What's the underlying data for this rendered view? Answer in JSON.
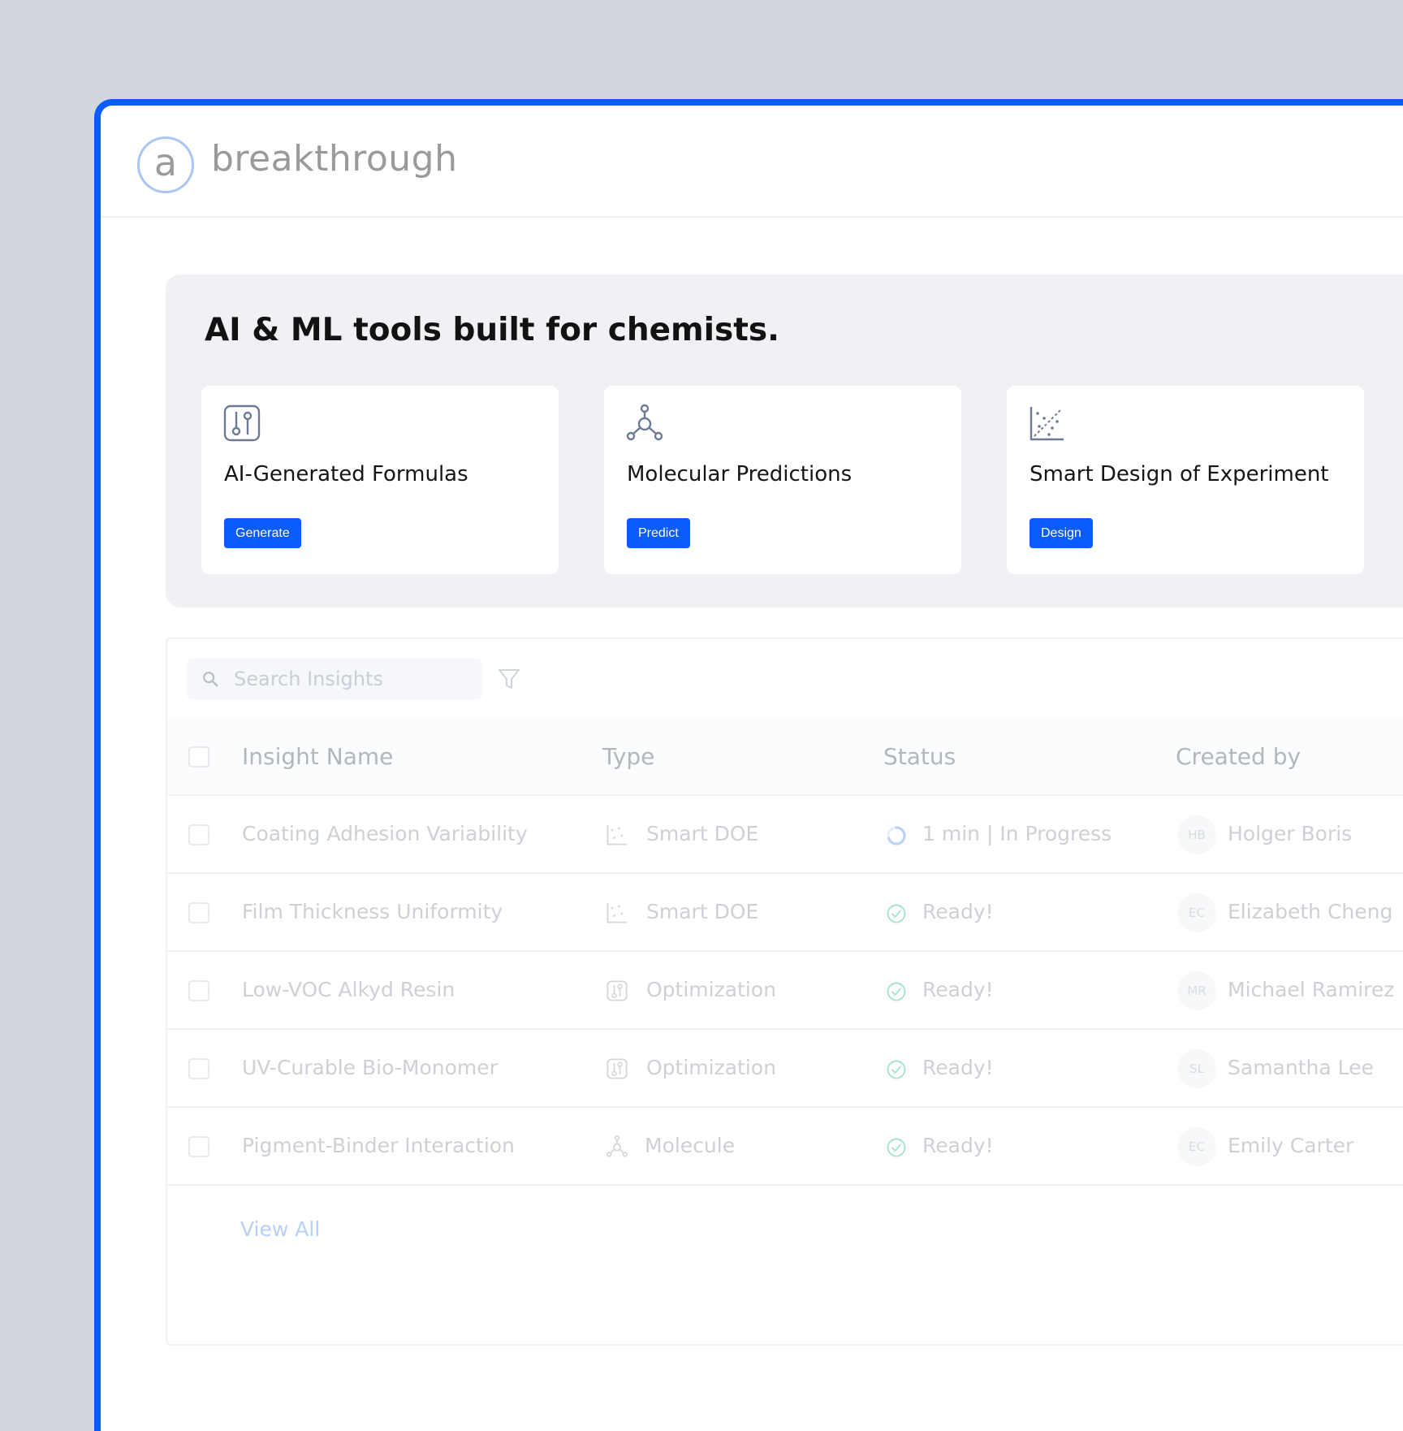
{
  "brand": {
    "logo_letter": "a",
    "name": "breakthrough"
  },
  "hero": {
    "title": "AI & ML tools built for chemists.",
    "tools": [
      {
        "icon": "sliders-icon",
        "title": "AI-Generated Formulas",
        "button": "Generate"
      },
      {
        "icon": "molecule-icon",
        "title": "Molecular Predictions",
        "button": "Predict"
      },
      {
        "icon": "scatter-chart-icon",
        "title": "Smart Design of Experiment",
        "button": "Design"
      }
    ]
  },
  "search": {
    "placeholder": "Search Insights"
  },
  "table": {
    "columns": [
      "Insight Name",
      "Type",
      "Status",
      "Created by"
    ],
    "rows": [
      {
        "name": "Coating Adhesion Variability",
        "type": "Smart DOE",
        "type_icon": "scatter-chart-icon",
        "status": "1 min | In Progress",
        "status_icon": "spinner-icon",
        "initials": "HB",
        "creator": "Holger Boris"
      },
      {
        "name": "Film Thickness Uniformity",
        "type": "Smart DOE",
        "type_icon": "scatter-chart-icon",
        "status": "Ready!",
        "status_icon": "check-circle-icon",
        "initials": "EC",
        "creator": "Elizabeth Cheng"
      },
      {
        "name": "Low-VOC Alkyd Resin",
        "type": "Optimization",
        "type_icon": "sliders-icon",
        "status": "Ready!",
        "status_icon": "check-circle-icon",
        "initials": "MR",
        "creator": "Michael Ramirez"
      },
      {
        "name": "UV-Curable Bio-Monomer",
        "type": "Optimization",
        "type_icon": "sliders-icon",
        "status": "Ready!",
        "status_icon": "check-circle-icon",
        "initials": "SL",
        "creator": "Samantha Lee"
      },
      {
        "name": "Pigment-Binder Interaction",
        "type": "Molecule",
        "type_icon": "molecule-icon",
        "status": "Ready!",
        "status_icon": "check-circle-icon",
        "initials": "EC",
        "creator": "Emily Carter"
      }
    ],
    "view_all": "View All"
  },
  "colors": {
    "accent": "#0b5cff",
    "background": "#d2d6de",
    "hero_bg": "#f0f1f5",
    "ready_green": "#a8e3d4",
    "progress_blue": "#b8d0f7"
  }
}
